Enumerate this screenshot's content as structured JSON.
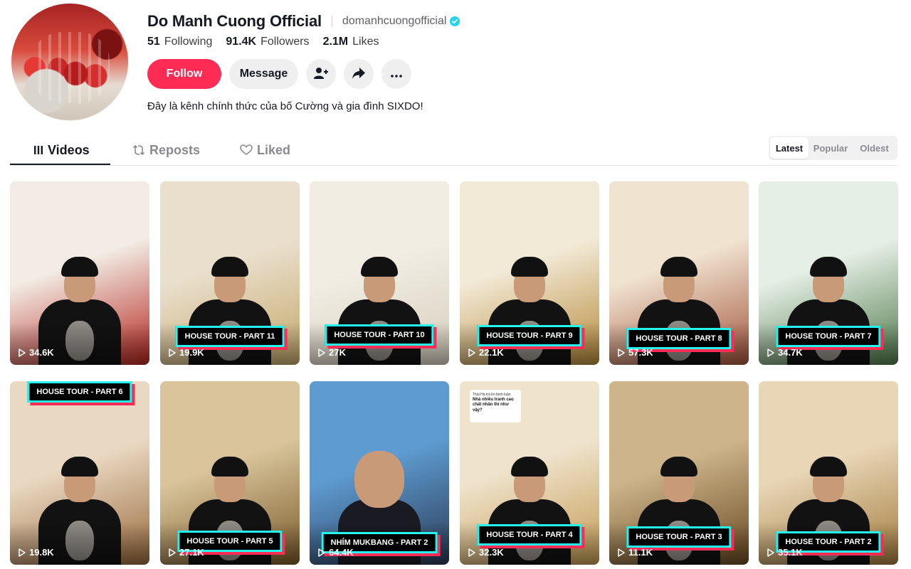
{
  "profile": {
    "display_name": "Do Manh Cuong Official",
    "username": "domanhcuongofficial",
    "verified": true,
    "stats": [
      {
        "num": "51",
        "label": "Following"
      },
      {
        "num": "91.4K",
        "label": "Followers"
      },
      {
        "num": "2.1M",
        "label": "Likes"
      }
    ],
    "follow_label": "Follow",
    "message_label": "Message",
    "bio": "Đây là kênh chính thức của bố Cường và gia đình SIXDO!"
  },
  "tabs": [
    {
      "label": "Videos",
      "icon": "grid-bars-icon",
      "active": true
    },
    {
      "label": "Reposts",
      "icon": "repost-icon",
      "active": false
    },
    {
      "label": "Liked",
      "icon": "heart-icon",
      "active": false
    }
  ],
  "sort": [
    {
      "label": "Latest",
      "active": true
    },
    {
      "label": "Popular",
      "active": false
    },
    {
      "label": "Oldest",
      "active": false
    }
  ],
  "videos": [
    {
      "views": "34.6K",
      "tag": "",
      "bg": [
        "#f2ece4",
        "#b5261f"
      ]
    },
    {
      "views": "19.9K",
      "tag": "HOUSE TOUR - PART 11",
      "bg": [
        "#eadfcd",
        "#c4a86a"
      ]
    },
    {
      "views": "27K",
      "tag": "HOUSE TOUR - PART 10",
      "bg": [
        "#f1ede3",
        "#d7cfbf"
      ]
    },
    {
      "views": "22.1K",
      "tag": "HOUSE TOUR - PART 9",
      "bg": [
        "#f2e9d6",
        "#b68a3a"
      ]
    },
    {
      "views": "57.3K",
      "tag": "HOUSE TOUR - PART 8",
      "bg": [
        "#f0e3d0",
        "#a4563c"
      ]
    },
    {
      "views": "34.7K",
      "tag": "HOUSE TOUR - PART 7",
      "bg": [
        "#e6efe6",
        "#4f7a4a"
      ]
    },
    {
      "views": "19.8K",
      "tag": "HOUSE TOUR - PART 6",
      "bg": [
        "#ead9c2",
        "#9a6a3d"
      ]
    },
    {
      "views": "27.1K",
      "tag": "HOUSE TOUR - PART 5",
      "bg": [
        "#d9c49b",
        "#7a5b2a"
      ]
    },
    {
      "views": "64.4K",
      "tag": "NHÍM MUKBANG - PART 2",
      "bg": [
        "#5d9bd0",
        "#2b3a55"
      ]
    },
    {
      "views": "32.3K",
      "tag": "HOUSE TOUR - PART 4",
      "bg": [
        "#efe3cc",
        "#c39a52"
      ]
    },
    {
      "views": "11.1K",
      "tag": "HOUSE TOUR - PART 3",
      "bg": [
        "#cdb48a",
        "#6a4a22"
      ]
    },
    {
      "views": "35.1K",
      "tag": "HOUSE TOUR - PART 2",
      "bg": [
        "#e8d6b6",
        "#a47c3e"
      ]
    }
  ],
  "comment_bubble": {
    "header": "Thái Hà trả lời bình luận",
    "text": "Nhà nhiều tranh cao chất nhân thì như vậy?"
  },
  "colors": {
    "accent": "#fe2c55",
    "cyan": "#25f4ee",
    "verified": "#20d5ec"
  }
}
